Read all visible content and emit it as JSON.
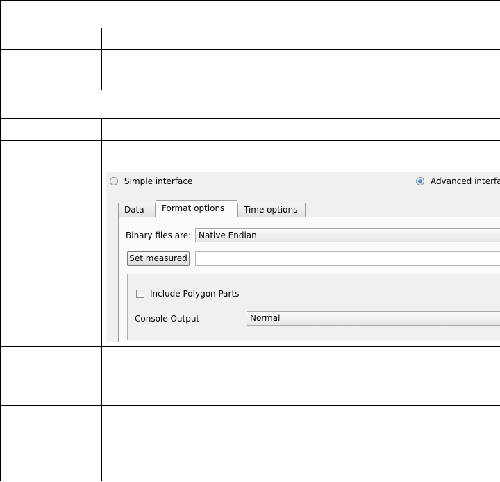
{
  "interface_mode": {
    "simple_label": "Simple interface",
    "advanced_label": "Advanced interfa",
    "selected": "advanced"
  },
  "tabs": [
    {
      "label": "Data",
      "active": false
    },
    {
      "label": "Format options",
      "active": true
    },
    {
      "label": "Time options",
      "active": false
    }
  ],
  "format_options": {
    "binary_label": "Binary files are:",
    "binary_value": "Native Endian",
    "set_measured_label": "Set measured",
    "set_measured_value": "",
    "include_polygon_parts_label": "Include Polygon Parts",
    "include_polygon_parts_checked": false,
    "console_output_label": "Console Output",
    "console_output_value": "Normal"
  }
}
